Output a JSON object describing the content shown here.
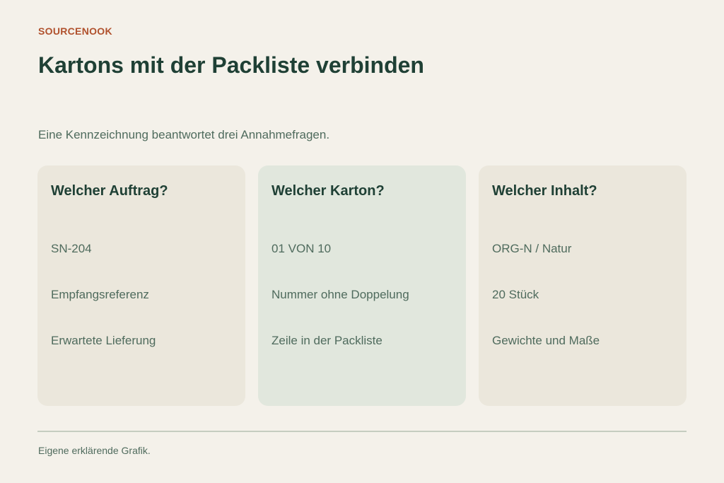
{
  "brand": "SOURCENOOK",
  "title": "Kartons mit der Packliste verbinden",
  "subtitle": "Eine Kennzeichnung beantwortet drei Annahmefragen.",
  "cards": [
    {
      "title": "Welcher Auftrag?",
      "lines": [
        "SN-204",
        "Empfangsreferenz",
        "Erwartete Lieferung"
      ]
    },
    {
      "title": "Welcher Karton?",
      "lines": [
        "01 VON 10",
        "Nummer ohne Doppelung",
        "Zeile in der Packliste"
      ]
    },
    {
      "title": "Welcher Inhalt?",
      "lines": [
        "ORG-N / Natur",
        "20 Stück",
        "Gewichte und Maße"
      ]
    }
  ],
  "footnote": "Eigene erklärende Grafik."
}
